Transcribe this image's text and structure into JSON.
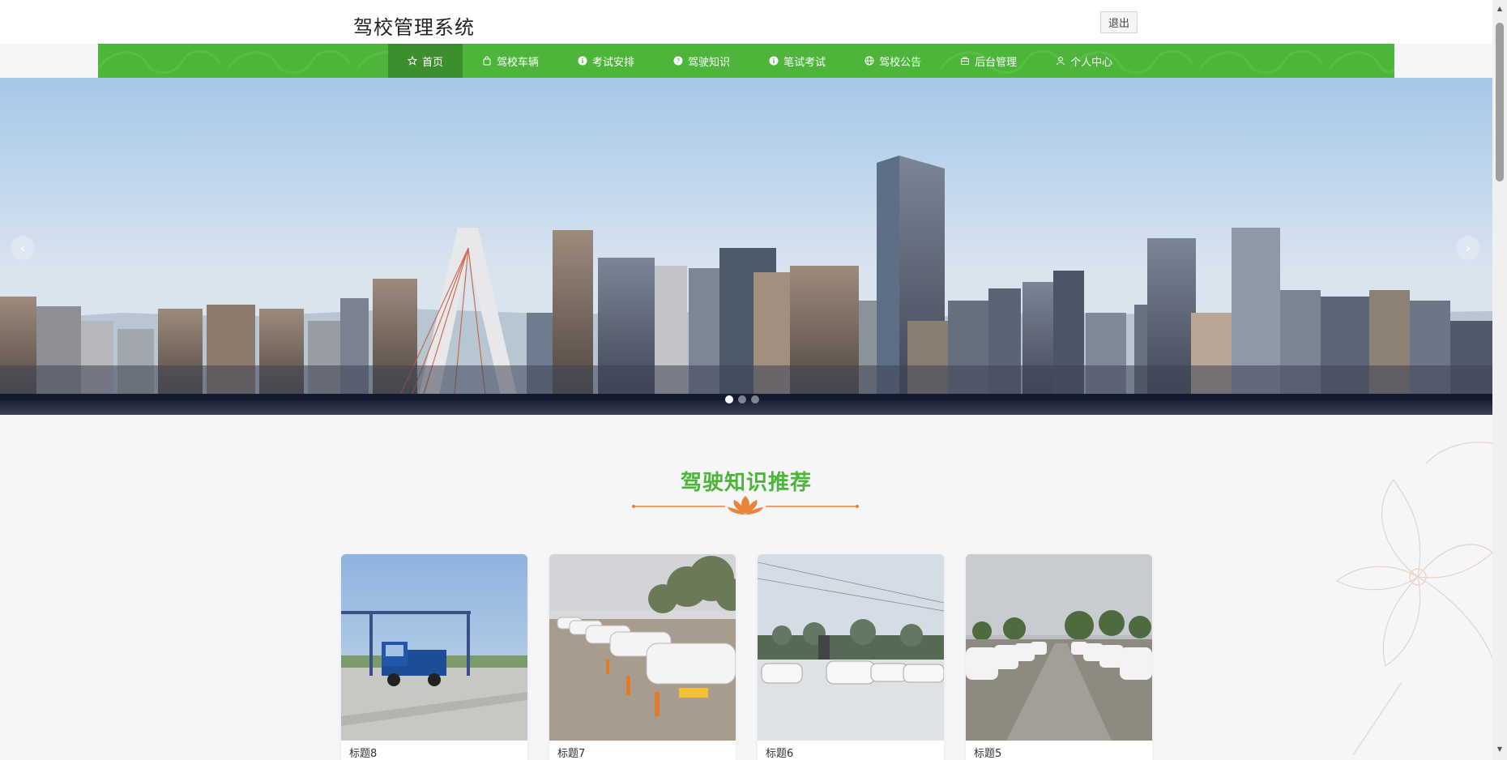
{
  "header": {
    "site_title": "驾校管理系统",
    "logout_label": "退出"
  },
  "nav": {
    "items": [
      {
        "label": "首页",
        "icon": "star-icon",
        "active": true
      },
      {
        "label": "驾校车辆",
        "icon": "bag-icon",
        "active": false
      },
      {
        "label": "考试安排",
        "icon": "info-circle-icon",
        "active": false
      },
      {
        "label": "驾驶知识",
        "icon": "question-circle-icon",
        "active": false
      },
      {
        "label": "笔试考试",
        "icon": "info-circle-icon",
        "active": false
      },
      {
        "label": "驾校公告",
        "icon": "globe-icon",
        "active": false
      },
      {
        "label": "后台管理",
        "icon": "briefcase-icon",
        "active": false
      },
      {
        "label": "个人中心",
        "icon": "user-icon",
        "active": false
      }
    ]
  },
  "banner": {
    "prev_label": "‹",
    "next_label": "›",
    "slide_count": 3,
    "active_slide": 1
  },
  "section": {
    "title": "驾驶知识推荐"
  },
  "cards": [
    {
      "title": "标题8"
    },
    {
      "title": "标题7"
    },
    {
      "title": "标题6"
    },
    {
      "title": "标题5"
    }
  ],
  "colors": {
    "brand_green": "#4db53a",
    "nav_active": "#3d8f2d",
    "divider_orange": "#e8843c"
  }
}
